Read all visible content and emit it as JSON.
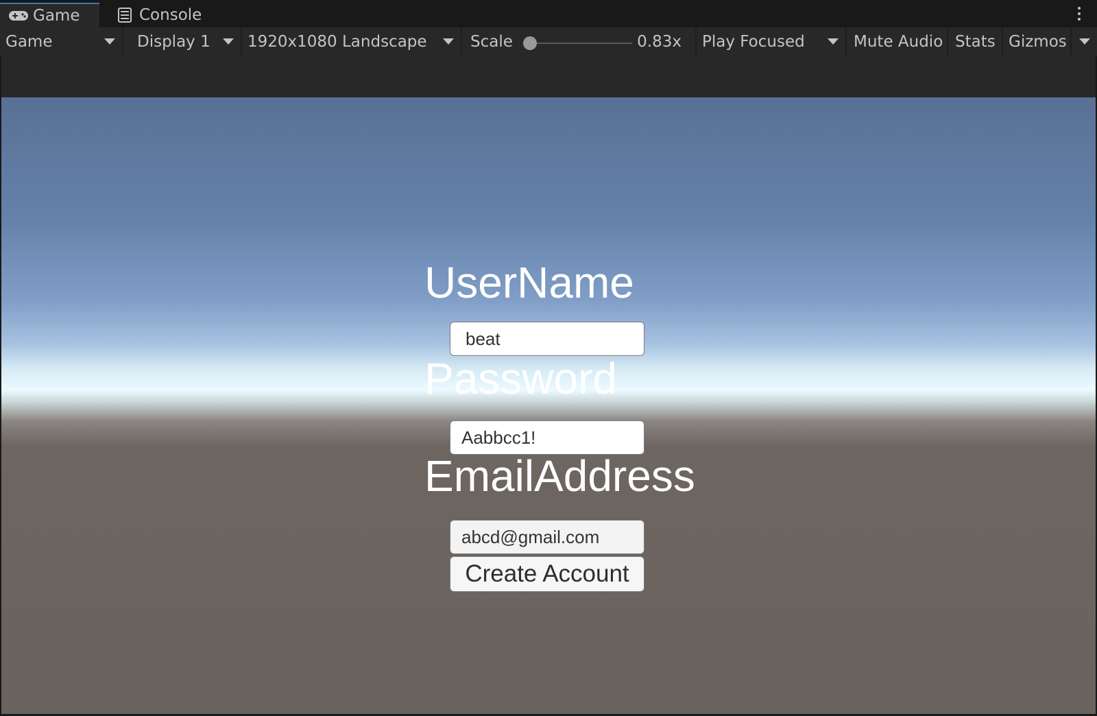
{
  "tabs": [
    {
      "label": "Game",
      "icon": "gamepad-icon"
    },
    {
      "label": "Console",
      "icon": "console-icon"
    }
  ],
  "toolbar": {
    "mode": "Game",
    "display": "Display 1",
    "resolution": "1920x1080 Landscape",
    "scale_label": "Scale",
    "scale_value": "0.83x",
    "play_mode": "Play Focused",
    "mute_audio": "Mute Audio",
    "stats": "Stats",
    "gizmos": "Gizmos"
  },
  "form": {
    "username_label": "UserName",
    "username_value": "beat",
    "password_label": "Password",
    "password_value": "Aabbcc1!",
    "email_label": "EmailAddress",
    "email_value": "abcd@gmail.com",
    "submit_label": "Create Account"
  },
  "colors": {
    "editor_bg": "#191919",
    "toolbar_bg": "#282828",
    "active_tab_accent": "#3a79bb",
    "sky_top": "#5a7095",
    "horizon": "#ecfaff",
    "ground": "#6a625d"
  }
}
